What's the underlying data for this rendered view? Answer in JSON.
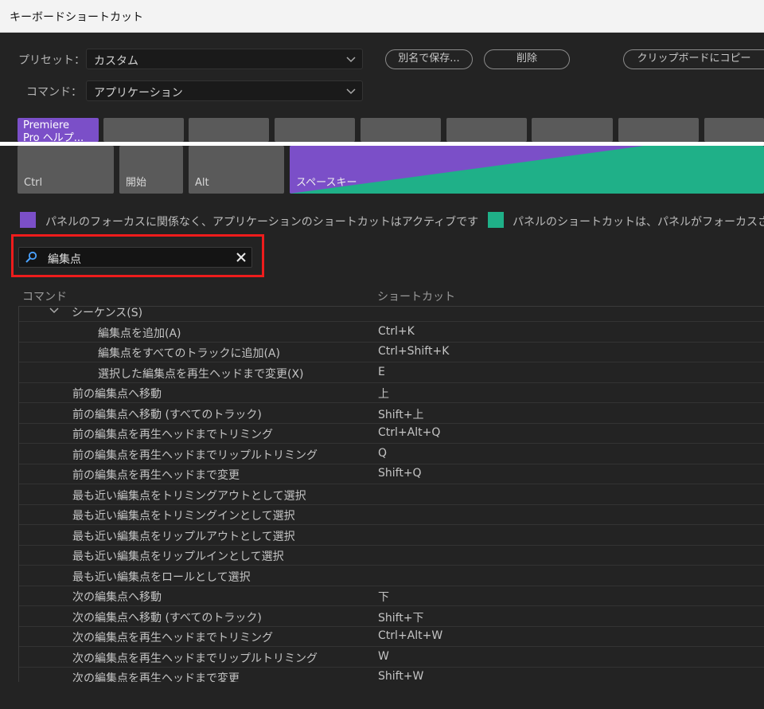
{
  "window": {
    "title": "キーボードショートカット"
  },
  "controls": {
    "preset_label": "プリセット：",
    "preset_value": "カスタム",
    "command_label": "コマンド：",
    "command_value": "アプリケーション",
    "save_as_button": "別名で保存...",
    "delete_button": "削除",
    "copy_clipboard_button": "クリップボードにコピー"
  },
  "keyboard": {
    "top_row_first_key": [
      "Premiere",
      "Pro ヘルプ..."
    ],
    "bottom_keys": {
      "ctrl": "Ctrl",
      "start": "開始",
      "alt": "Alt",
      "space": "スペースキー"
    }
  },
  "legend": {
    "app_color": "#7b4fc8",
    "app_text": "パネルのフォーカスに関係なく、アプリケーションのショートカットはアクティブです",
    "panel_color": "#1fb088",
    "panel_text": "パネルのショートカットは、パネルがフォーカスさ"
  },
  "search": {
    "value": "編集点"
  },
  "table": {
    "headers": {
      "command": "コマンド",
      "shortcut": "ショートカット"
    },
    "rows": [
      {
        "command": "シーケンス(S)",
        "shortcut": "",
        "level": 0,
        "group": true
      },
      {
        "command": "編集点を追加(A)",
        "shortcut": "Ctrl+K",
        "level": 2
      },
      {
        "command": "編集点をすべてのトラックに追加(A)",
        "shortcut": "Ctrl+Shift+K",
        "level": 2
      },
      {
        "command": "選択した編集点を再生ヘッドまで変更(X)",
        "shortcut": "E",
        "level": 2
      },
      {
        "command": "前の編集点へ移動",
        "shortcut": "上",
        "level": 1
      },
      {
        "command": "前の編集点へ移動 (すべてのトラック)",
        "shortcut": "Shift+上",
        "level": 1
      },
      {
        "command": "前の編集点を再生ヘッドまでトリミング",
        "shortcut": "Ctrl+Alt+Q",
        "level": 1
      },
      {
        "command": "前の編集点を再生ヘッドまでリップルトリミング",
        "shortcut": "Q",
        "level": 1
      },
      {
        "command": "前の編集点を再生ヘッドまで変更",
        "shortcut": "Shift+Q",
        "level": 1
      },
      {
        "command": "最も近い編集点をトリミングアウトとして選択",
        "shortcut": "",
        "level": 1
      },
      {
        "command": "最も近い編集点をトリミングインとして選択",
        "shortcut": "",
        "level": 1
      },
      {
        "command": "最も近い編集点をリップルアウトとして選択",
        "shortcut": "",
        "level": 1
      },
      {
        "command": "最も近い編集点をリップルインとして選択",
        "shortcut": "",
        "level": 1
      },
      {
        "command": "最も近い編集点をロールとして選択",
        "shortcut": "",
        "level": 1
      },
      {
        "command": "次の編集点へ移動",
        "shortcut": "下",
        "level": 1
      },
      {
        "command": "次の編集点へ移動 (すべてのトラック)",
        "shortcut": "Shift+下",
        "level": 1
      },
      {
        "command": "次の編集点を再生ヘッドまでトリミング",
        "shortcut": "Ctrl+Alt+W",
        "level": 1
      },
      {
        "command": "次の編集点を再生ヘッドまでリップルトリミング",
        "shortcut": "W",
        "level": 1
      },
      {
        "command": "次の編集点を再生ヘッドまで変更",
        "shortcut": "Shift+W",
        "level": 1
      }
    ]
  }
}
